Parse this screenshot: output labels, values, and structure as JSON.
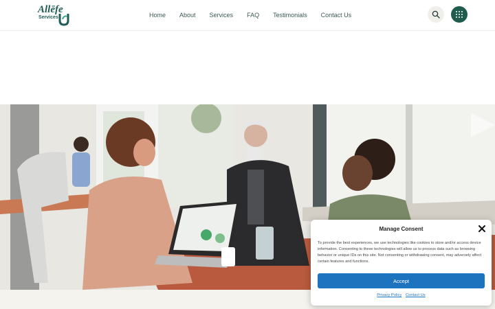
{
  "header": {
    "logo": {
      "text": "Allēfe",
      "sub": "Services"
    },
    "nav": [
      {
        "label": "Home"
      },
      {
        "label": "About"
      },
      {
        "label": "Services"
      },
      {
        "label": "FAQ"
      },
      {
        "label": "Testimonials"
      },
      {
        "label": "Contact Us"
      }
    ],
    "icons": {
      "search": "search-icon",
      "menu": "grid-menu-icon"
    },
    "colors": {
      "brand": "#1f5c4d",
      "accent": "#3aa88a"
    }
  },
  "hero": {
    "image": "office-meeting-photo"
  },
  "consent": {
    "title": "Manage Consent",
    "body": "To provide the best experiences, we use technologies like cookies to store and/or access device information. Consenting to these technologies will allow us to process data such as browsing behavior or unique IDs on this site. Not consenting or withdrawing consent, may adversely affect certain features and functions.",
    "accept": "Accept",
    "links": [
      "Privacy Policy",
      "Contact Us"
    ],
    "colors": {
      "button": "#1e73be"
    }
  }
}
